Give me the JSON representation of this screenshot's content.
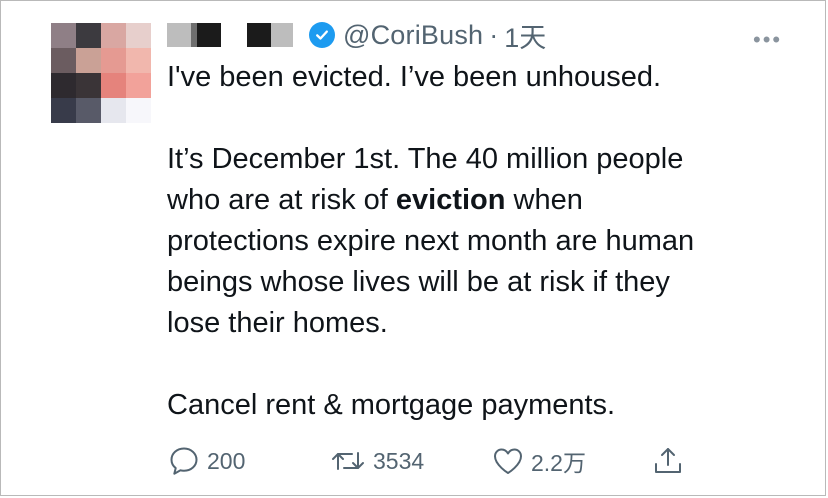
{
  "tweet": {
    "handle": "@CoriBush",
    "separator": "·",
    "time": "1天",
    "more_label": "•••",
    "lines": {
      "l1": "I've been evicted. I’ve been unhoused.",
      "l2": "It’s December 1st. The 40 million people",
      "l3a": "who are at risk of ",
      "l3b": "eviction",
      "l3c": " when",
      "l4": "protections expire next month are human",
      "l5": "beings whose lives will be at risk if they",
      "l6": "lose their homes.",
      "l7": "Cancel rent & mortgage payments."
    },
    "actions": {
      "reply_count": "200",
      "retweet_count": "3534",
      "like_count": "2.2万"
    },
    "icons": {
      "reply": "reply-icon",
      "retweet": "retweet-icon",
      "like": "heart-icon",
      "share": "share-icon",
      "verified": "verified-badge-icon"
    },
    "colors": {
      "verified": "#1d9bf0",
      "text": "#0f1419",
      "muted": "#536471"
    }
  }
}
